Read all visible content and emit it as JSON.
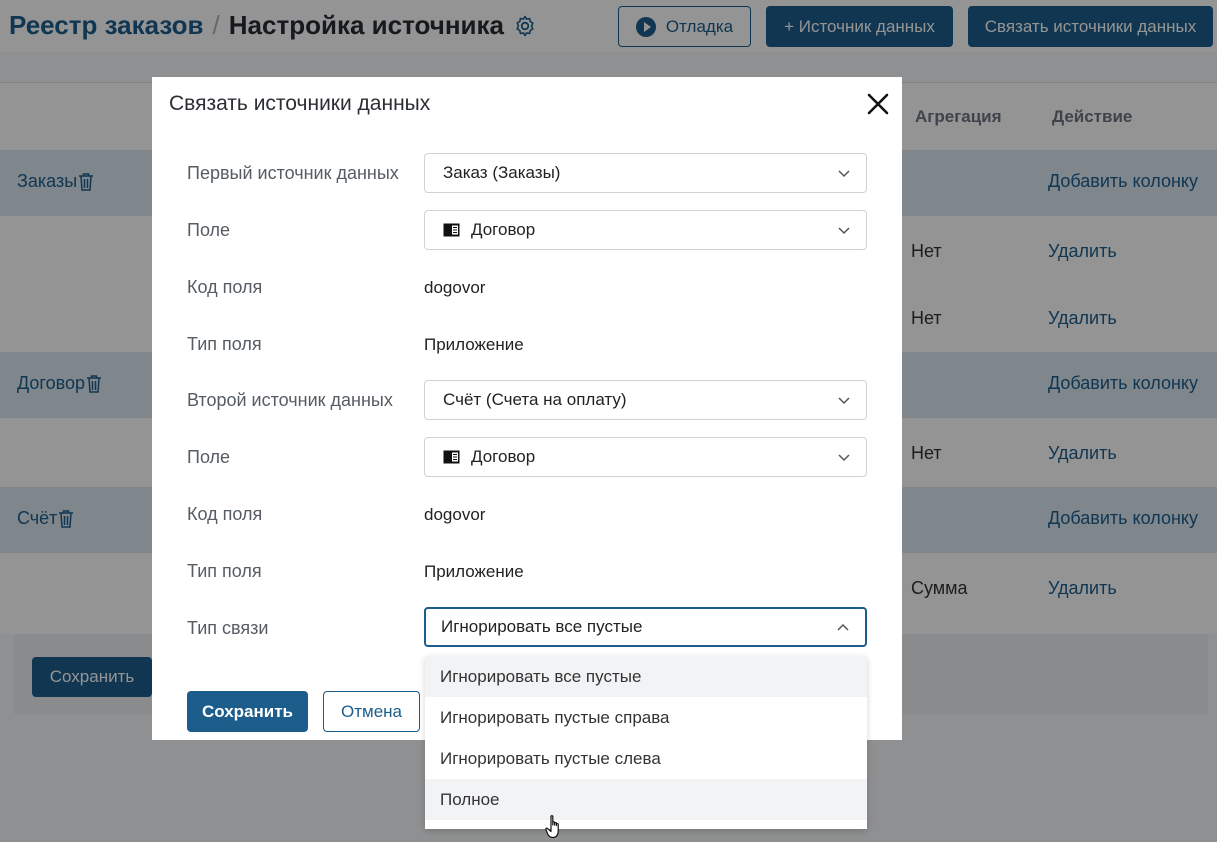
{
  "header": {
    "breadcrumb_root": "Реестр заказов",
    "breadcrumb_sep": "/",
    "page_title": "Настройка источника",
    "debug_label": "Отладка",
    "add_source_label": "+ Источник данных",
    "link_sources_label": "Связать источники данных"
  },
  "table": {
    "columns": {
      "aggregation": "Агрегация",
      "action": "Действие"
    },
    "groups": [
      {
        "name": "Заказы",
        "add_label": "Добавить колонку"
      },
      {
        "name": "Договор",
        "add_label": "Добавить колонку"
      },
      {
        "name": "Счёт",
        "add_label": "Добавить колонку"
      }
    ],
    "rows": [
      {
        "aggregation": "Нет",
        "action": "Удалить"
      },
      {
        "aggregation": "Нет",
        "action": "Удалить"
      },
      {
        "aggregation": "Нет",
        "action": "Удалить"
      },
      {
        "aggregation": "Сумма",
        "action": "Удалить"
      }
    ],
    "save_label": "Сохранить"
  },
  "modal": {
    "title": "Связать источники данных",
    "first_source_label": "Первый источник данных",
    "first_source_value": "Заказ (Заказы)",
    "field1_label": "Поле",
    "field1_value": "Договор",
    "code1_label": "Код поля",
    "code1_value": "dogovor",
    "type1_label": "Тип поля",
    "type1_value": "Приложение",
    "second_source_label": "Второй источник данных",
    "second_source_value": "Счёт (Счета на оплату)",
    "field2_label": "Поле",
    "field2_value": "Договор",
    "code2_label": "Код поля",
    "code2_value": "dogovor",
    "type2_label": "Тип поля",
    "type2_value": "Приложение",
    "link_type_label": "Тип связи",
    "link_type_value": "Игнорировать все пустые",
    "save_label": "Сохранить",
    "cancel_label": "Отмена"
  },
  "dropdown": {
    "options": [
      "Игнорировать все пустые",
      "Игнорировать пустые справа",
      "Игнорировать пустые слева",
      "Полное"
    ]
  },
  "colors": {
    "primary": "#1c5d8c",
    "group_row": "#dbe8f3",
    "overlay": "rgba(0,0,0,0.42)"
  }
}
